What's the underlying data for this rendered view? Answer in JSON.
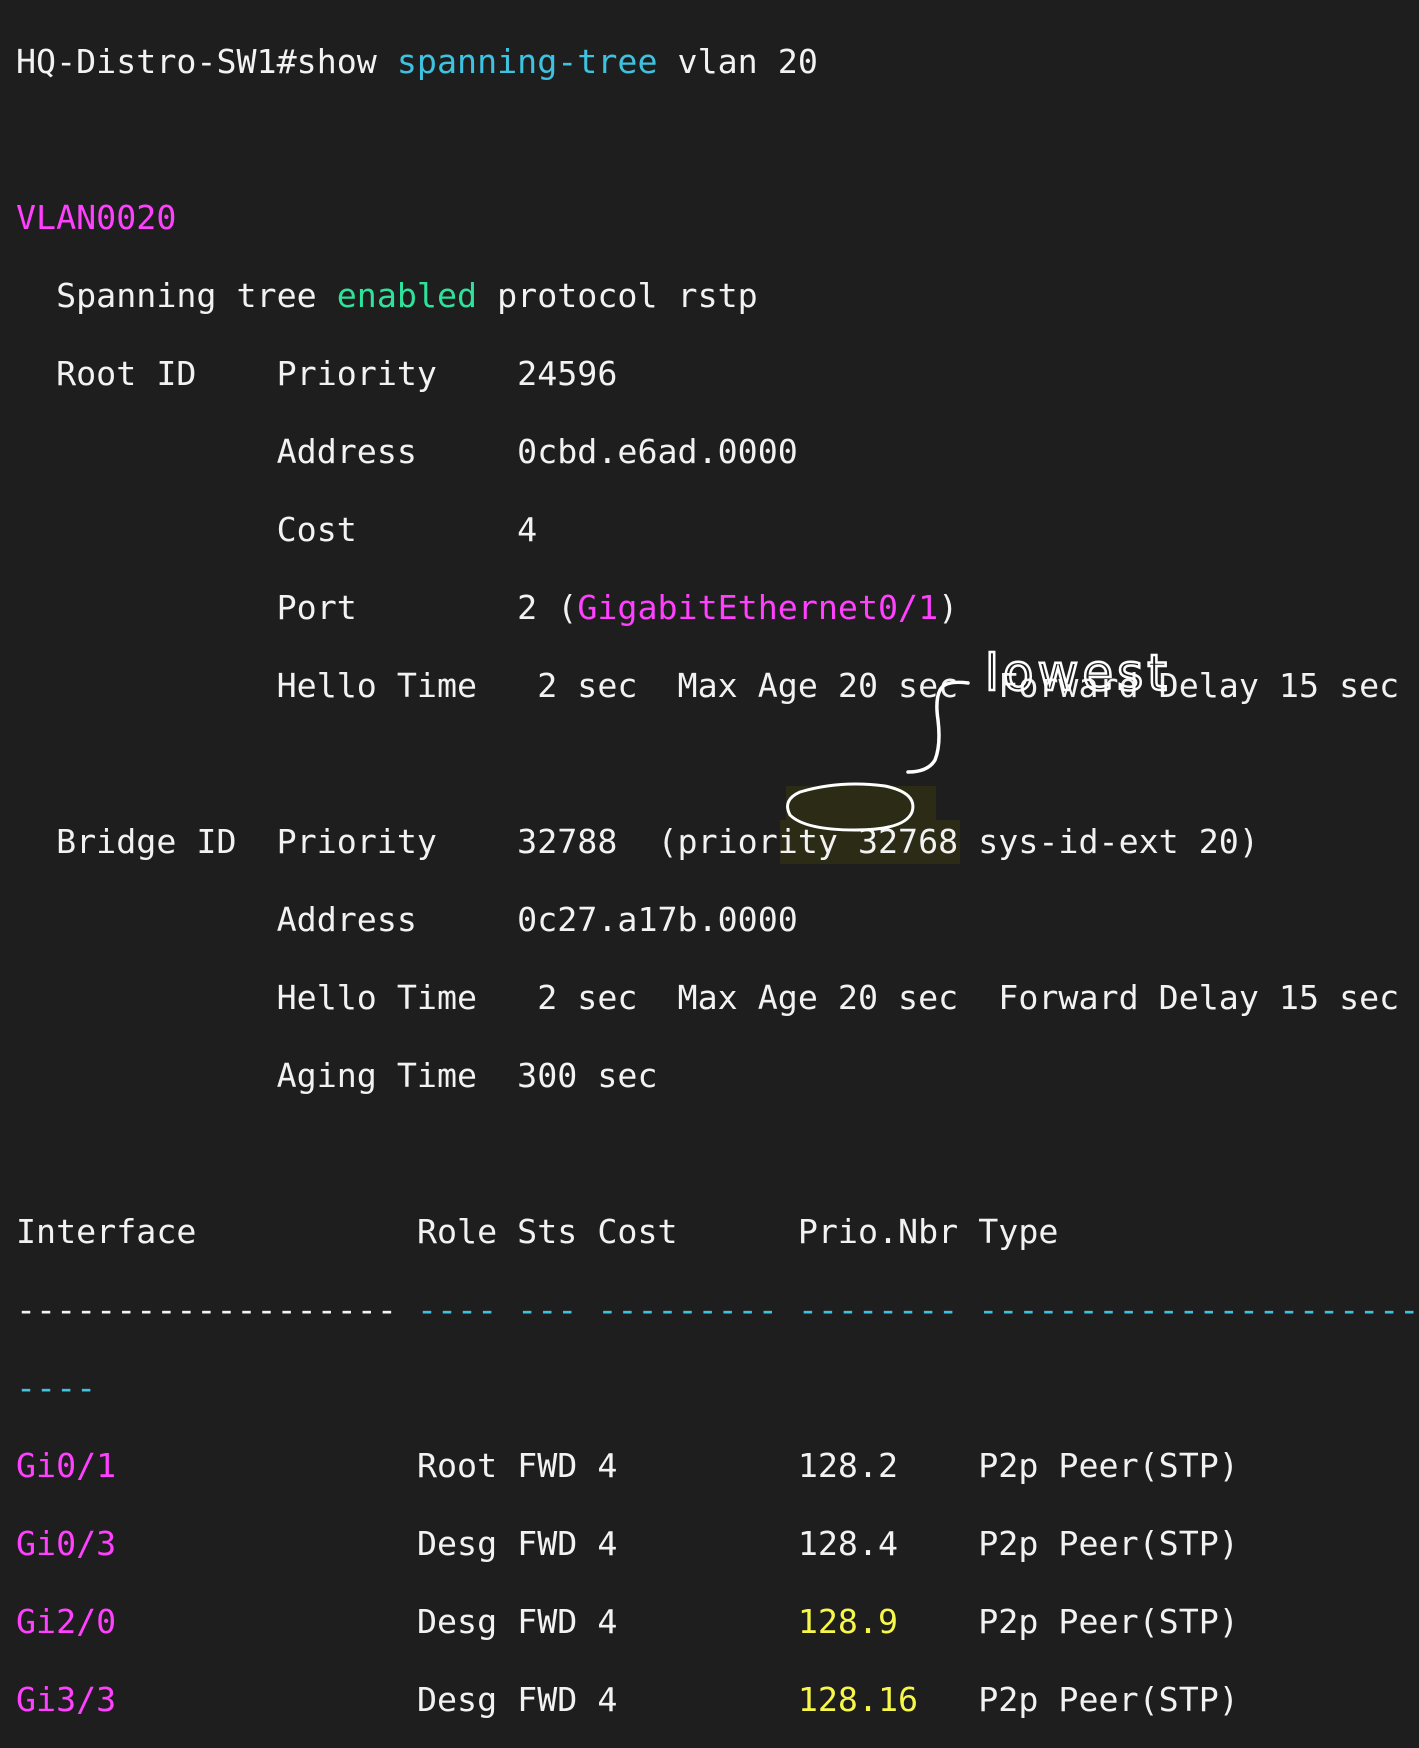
{
  "terminal": {
    "prompt": "HQ-Distro-SW1#",
    "command_show": "show",
    "command_arg": "spanning-tree",
    "command_vlan": "vlan 20",
    "vlan_name": "VLAN0020",
    "stp_prefix": "Spanning tree",
    "stp_enabled": "enabled",
    "stp_suffix": "protocol rstp",
    "root": {
      "label": "Root ID",
      "priority_label": "Priority",
      "priority_value": "24596",
      "address_label": "Address",
      "address_value": "0cbd.e6ad.0000",
      "cost_label": "Cost",
      "cost_value": "4",
      "port_label": "Port",
      "port_value_prefix": "2 (",
      "port_value_iface": "GigabitEthernet0/1",
      "port_value_suffix": ")",
      "hello_label": "Hello Time",
      "timers": "2 sec  Max Age 20 sec  Forward Delay 15 sec"
    },
    "bridge": {
      "label": "Bridge ID",
      "priority_label": "Priority",
      "priority_value": "32788  (priority 32768 sys-id-ext 20)",
      "address_label": "Address",
      "address_value": "0c27.a17b.0000",
      "hello_label": "Hello Time",
      "timers": "2 sec  Max Age 20 sec  Forward Delay 15 sec",
      "aging_label": "Aging Time",
      "aging_value": "300 sec"
    },
    "table": {
      "headers": {
        "interface": "Interface",
        "role": "Role",
        "sts": "Sts",
        "cost": "Cost",
        "prio_nbr": "Prio.Nbr",
        "type": "Type"
      },
      "dash_interface": "-------------------",
      "dash_role": "----",
      "dash_sts": "---",
      "dash_cost": "---------",
      "dash_prio": "--------",
      "dash_type": "------------------------",
      "dash_wrap": "----",
      "rows": [
        {
          "iface": "Gi0/1",
          "role": "Root",
          "sts": "FWD",
          "cost": "4",
          "prio": "128.2",
          "type": "P2p Peer(STP)"
        },
        {
          "iface": "Gi0/3",
          "role": "Desg",
          "sts": "FWD",
          "cost": "4",
          "prio": "128.4",
          "type": "P2p Peer(STP)"
        },
        {
          "iface": "Gi2/0",
          "role": "Desg",
          "sts": "FWD",
          "cost": "4",
          "prio": "128.9",
          "type": "P2p Peer(STP)"
        },
        {
          "iface": "Gi3/3",
          "role": "Desg",
          "sts": "FWD",
          "cost": "4",
          "prio": "128.16",
          "type": "P2p Peer(STP)"
        }
      ]
    }
  },
  "annotation": {
    "label": "lowest"
  },
  "colors": {
    "background": "#1e1e1e",
    "text": "#f2f2f2",
    "cyan": "#3ec2e0",
    "magenta": "#ff40ff",
    "green": "#2ee29b",
    "highlight": "#f7f74a",
    "ink": "#ffffff"
  }
}
